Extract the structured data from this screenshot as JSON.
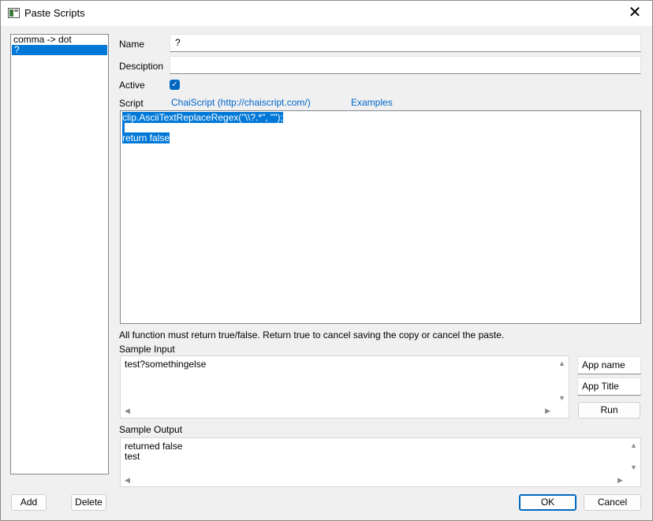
{
  "window": {
    "title": "Paste Scripts",
    "close_symbol": "✕"
  },
  "script_list": {
    "items": [
      "comma -> dot",
      "?"
    ],
    "selected_index": 1
  },
  "form": {
    "name_label": "Name",
    "name_value": "?",
    "description_label": "Desciption",
    "description_value": "",
    "active_label": "Active",
    "active_checked": true,
    "script_label": "Script",
    "chaiscript_link": "ChaiScript (http://chaiscript.com/)",
    "examples_link": "Examples",
    "script_lines": [
      "clip.AsciiTextReplaceRegex(\"\\\\?.*\", \"\");",
      "",
      "return false"
    ],
    "hint": "All function must return true/false.  Return true to cancel saving the copy or cancel the paste."
  },
  "sample_input": {
    "label": "Sample Input",
    "text": "test?somethingelse"
  },
  "side_fields": {
    "app_name": "App name",
    "app_title": "App Title",
    "run_label": "Run"
  },
  "sample_output": {
    "label": "Sample Output",
    "text": "returned false\ntest"
  },
  "footer": {
    "add_label": "Add",
    "delete_label": "Delete",
    "ok_label": "OK",
    "cancel_label": "Cancel"
  },
  "colors": {
    "accent": "#0078d7",
    "link": "#0066cc"
  }
}
